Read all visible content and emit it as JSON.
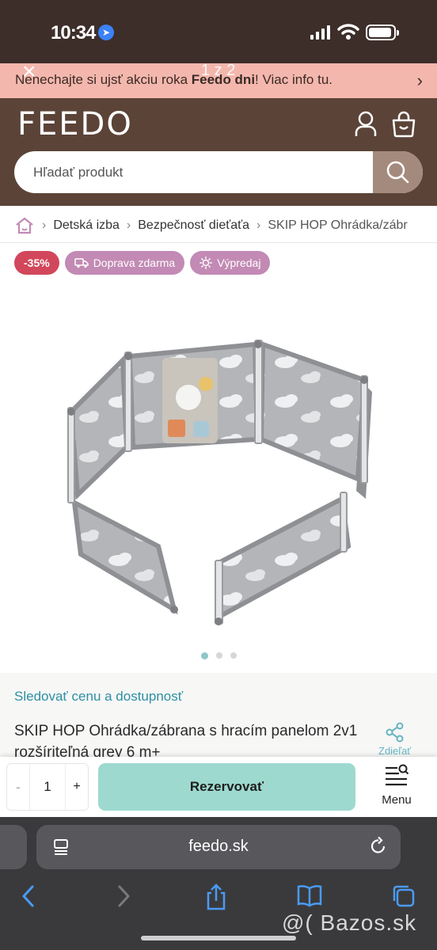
{
  "status": {
    "time": "10:34"
  },
  "promo": {
    "counter": "1 z 2",
    "text_prefix": "Nenechajte si ujsť akciu roka ",
    "text_bold": "Feedo dni",
    "text_suffix": "! Viac info tu."
  },
  "header": {
    "logo": "FEEDO",
    "search_placeholder": "Hľadať produkt"
  },
  "breadcrumb": [
    "Detská izba",
    "Bezpečnosť dieťaťa",
    "SKIP HOP Ohrádka/zábr"
  ],
  "badges": {
    "discount": "-35%",
    "shipping": "Doprava zdarma",
    "sale": "Výpredaj"
  },
  "gallery": {
    "dots": 3,
    "active": 0
  },
  "product": {
    "track_link": "Sledovať cenu a dostupnosť",
    "title": "SKIP HOP Ohrádka/zábrana s hracím panelom 2v1 rozšíriteľná grey 6 m+",
    "share_label": "Zdieľať"
  },
  "buybar": {
    "qty_minus": "-",
    "qty_value": "1",
    "qty_plus": "+",
    "reserve_label": "Rezervovať",
    "menu_label": "Menu"
  },
  "safari": {
    "url": "feedo.sk"
  },
  "watermark": "@( Bazos.sk",
  "colors": {
    "header_bg": "#5b4338",
    "promo_bg": "#f4b7ad",
    "discount": "#d2475b",
    "badge": "#c28ab4",
    "cta": "#9dd9cf",
    "link": "#2d8fa3"
  }
}
